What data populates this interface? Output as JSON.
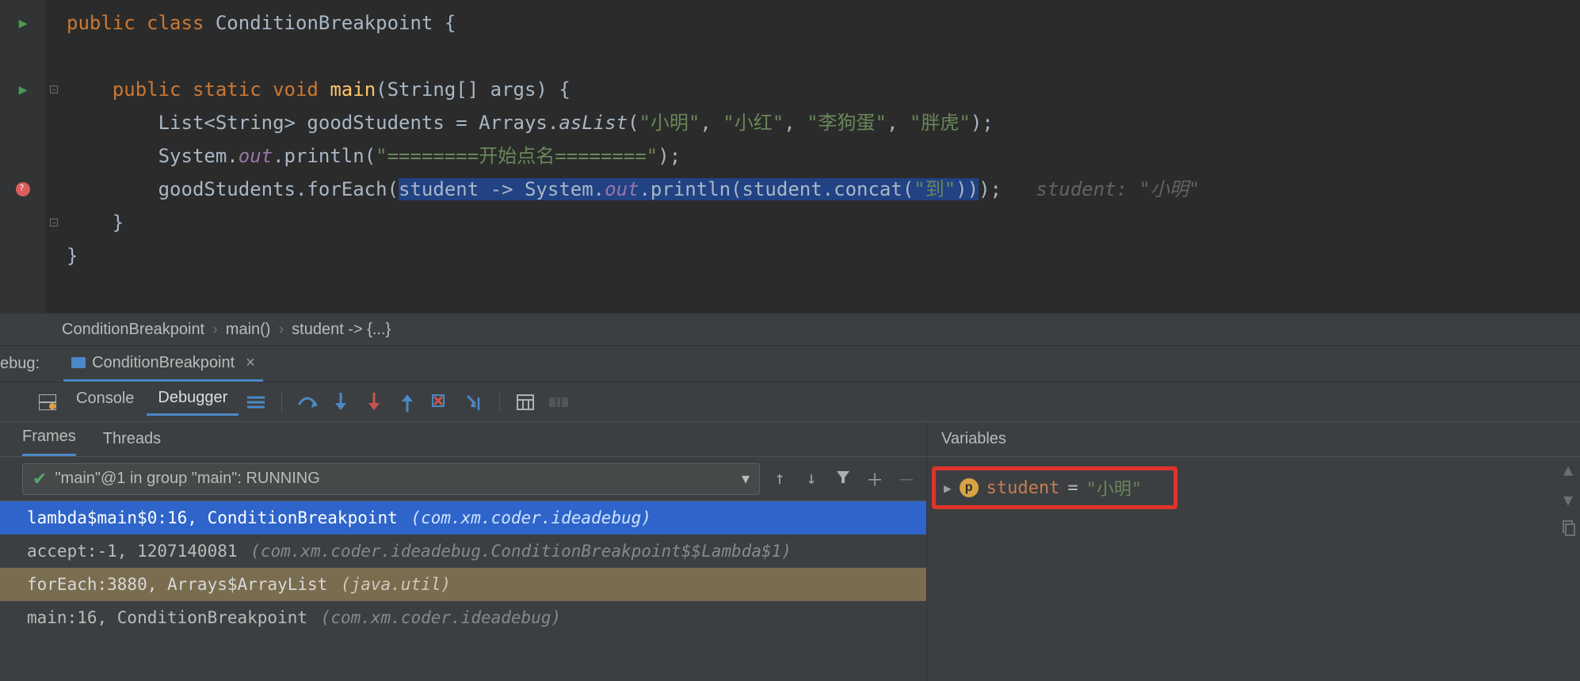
{
  "code": {
    "class_decl_kw": "public class",
    "class_name": "ConditionBreakpoint",
    "main_sig_kw": "public static void",
    "main_name": "main",
    "main_params": "(String[] args) {",
    "list_decl": "List<String> goodStudents = Arrays.",
    "asList": "asList",
    "names": [
      "\"小明\"",
      "\"小红\"",
      "\"李狗蛋\"",
      "\"胖虎\""
    ],
    "sysout1_a": "System.",
    "sysout1_b": "out",
    "sysout1_c": ".println(",
    "startStr": "\"========开始点名========\"",
    "forEach_a": "goodStudents.forEach(",
    "lambda_hl": "student -> System.",
    "lambda_out": "out",
    "lambda_tail": ".println(student.concat(",
    "dao": "\"到\"",
    "lambda_close": "))",
    "forEach_close": ");",
    "inlay": "student: \"小明\""
  },
  "breadcrumb": {
    "a": "ConditionBreakpoint",
    "b": "main()",
    "c": "student -> {...}"
  },
  "debugHeader": {
    "prefix": "ebug:",
    "tab": "ConditionBreakpoint"
  },
  "toolbar": {
    "console": "Console",
    "debugger": "Debugger"
  },
  "frames": {
    "tabs": {
      "frames": "Frames",
      "threads": "Threads"
    },
    "thread": "\"main\"@1 in group \"main\": RUNNING",
    "rows": [
      {
        "main": "lambda$main$0:16, ConditionBreakpoint",
        "pkg": "(com.xm.coder.ideadebug)",
        "sel": true
      },
      {
        "main": "accept:-1, 1207140081",
        "pkg": "(com.xm.coder.ideadebug.ConditionBreakpoint$$Lambda$1)",
        "lib": false
      },
      {
        "main": "forEach:3880, Arrays$ArrayList",
        "pkg": "(java.util)",
        "lib": true
      },
      {
        "main": "main:16, ConditionBreakpoint",
        "pkg": "(com.xm.coder.ideadebug)",
        "lib": false
      }
    ]
  },
  "variables": {
    "title": "Variables",
    "name": "student",
    "eq": " = ",
    "val": "\"小明\""
  }
}
